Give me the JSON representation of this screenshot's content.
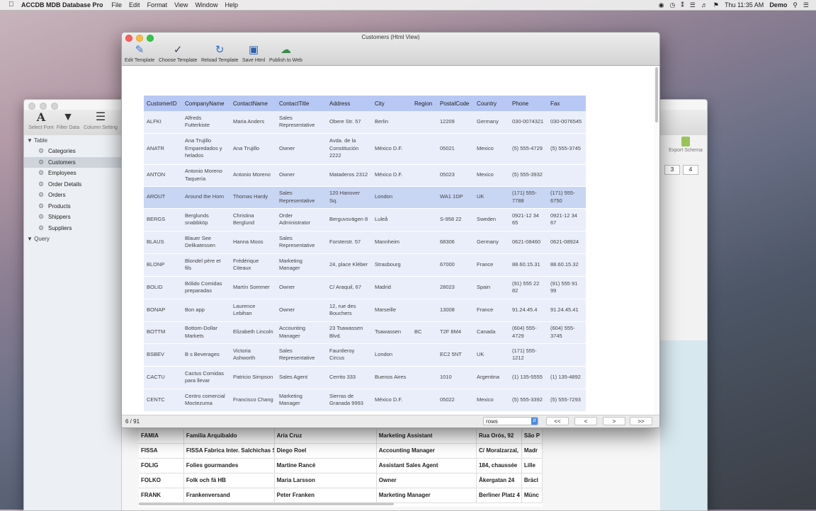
{
  "menubar": {
    "app_name": "ACCDB MDB Database Pro",
    "menus": [
      "File",
      "Edit",
      "Format",
      "View",
      "Window",
      "Help"
    ],
    "clock": "Thu 11:35 AM",
    "user": "Demo"
  },
  "bg_window": {
    "tools": [
      {
        "label": "Select Font",
        "icon": "font-icon"
      },
      {
        "label": "Filter Data",
        "icon": "filter-icon"
      },
      {
        "label": "Column Setting",
        "icon": "column-setting-icon"
      }
    ],
    "sidebar": {
      "table_header": "Table",
      "items": [
        "Categories",
        "Customers",
        "Employees",
        "Order Details",
        "Orders",
        "Products",
        "Shippers",
        "Suppliers"
      ],
      "selected": "Customers",
      "query_header": "Query"
    },
    "export_label": "Export Schema",
    "page_numbers": [
      "3",
      "4"
    ],
    "grid_rows": [
      [
        "FAMIA",
        "Familia Arquibaldo",
        "Aria Cruz",
        "Marketing Assistant",
        "Rua Orós, 92",
        "São P"
      ],
      [
        "FISSA",
        "FISSA Fabrica Inter. Salchichas S",
        "Diego Roel",
        "Accounting Manager",
        "C/ Moralzarzal,",
        "Madr"
      ],
      [
        "FOLIG",
        "Folies gourmandes",
        "Martine Rancé",
        "Assistant Sales Agent",
        "184, chaussée",
        "Lille"
      ],
      [
        "FOLKO",
        "Folk och fä HB",
        "Maria Larsson",
        "Owner",
        "Åkergatan 24",
        "Bräcl"
      ],
      [
        "FRANK",
        "Frankenversand",
        "Peter Franken",
        "Marketing Manager",
        "Berliner Platz 4",
        "Münc"
      ]
    ]
  },
  "window": {
    "title": "Customers (Html View)",
    "toolbar": [
      {
        "label": "Edit Template",
        "icon": "edit-template-icon"
      },
      {
        "label": "Choose Template",
        "icon": "choose-template-icon"
      },
      {
        "label": "Reload Template",
        "icon": "reload-template-icon"
      },
      {
        "label": "Save Html",
        "icon": "save-html-icon"
      },
      {
        "label": "Publish to Web",
        "icon": "publish-web-icon"
      }
    ],
    "columns": [
      "CustomerID",
      "CompanyName",
      "ContactName",
      "ContactTitle",
      "Address",
      "City",
      "Region",
      "PostalCode",
      "Country",
      "Phone",
      "Fax"
    ],
    "rows": [
      [
        "ALFKI",
        "Alfreds Futterkiste",
        "Maria Anders",
        "Sales Representative",
        "Obere Str. 57",
        "Berlin",
        "",
        "12209",
        "Germany",
        "030-0074321",
        "030-0076545"
      ],
      [
        "ANATR",
        "Ana Trujillo Emparedados y helados",
        "Ana Trujillo",
        "Owner",
        "Avda. de la Constitución 2222",
        "México D.F.",
        "",
        "05021",
        "Mexico",
        "(5) 555-4729",
        "(5) 555-3745"
      ],
      [
        "ANTON",
        "Antonio Moreno Taquería",
        "Antonio Moreno",
        "Owner",
        "Mataderos 2312",
        "México D.F.",
        "",
        "05023",
        "Mexico",
        "(5) 555-3932",
        ""
      ],
      [
        "AROUT",
        "Around the Horn",
        "Thomas Hardy",
        "Sales Representative",
        "120 Hanover Sq.",
        "London",
        "",
        "WA1 1DP",
        "UK",
        "(171) 555-7788",
        "(171) 555-6750"
      ],
      [
        "BERGS",
        "Berglunds snabbköp",
        "Christina Berglund",
        "Order Administrator",
        "Berguvsvägen 8",
        "Luleå",
        "",
        "S-958 22",
        "Sweden",
        "0921-12 34 65",
        "0921-12 34 67"
      ],
      [
        "BLAUS",
        "Blauer See Delikatessen",
        "Hanna Moos",
        "Sales Representative",
        "Forsterstr. 57",
        "Mannheim",
        "",
        "68306",
        "Germany",
        "0621-08460",
        "0621-08924"
      ],
      [
        "BLONP",
        "Blondel père et fils",
        "Frédérique Citeaux",
        "Marketing Manager",
        "24, place Kléber",
        "Strasbourg",
        "",
        "67000",
        "France",
        "88.60.15.31",
        "88.60.15.32"
      ],
      [
        "BOLID",
        "Bólido Comidas preparadas",
        "Martín Sommer",
        "Owner",
        "C/ Araquil, 67",
        "Madrid",
        "",
        "28023",
        "Spain",
        "(91) 555 22 82",
        "(91) 555 91 99"
      ],
      [
        "BONAP",
        "Bon app",
        "Laurence Lebihan",
        "Owner",
        "12, rue des Bouchers",
        "Marseille",
        "",
        "13008",
        "France",
        "91.24.45.4",
        "91.24.45.41"
      ],
      [
        "BOTTM",
        "Bottom-Dollar Markets",
        "Elizabeth Lincoln",
        "Accounting Manager",
        "23 Tsawassen Blvd.",
        "Tsawassen",
        "BC",
        "T2F 8M4",
        "Canada",
        "(604) 555-4729",
        "(604) 555-3745"
      ],
      [
        "BSBEV",
        "B s Beverages",
        "Victoria Ashworth",
        "Sales Representative",
        "Fauntleroy Circus",
        "London",
        "",
        "EC2 5NT",
        "UK",
        "(171) 555-1212",
        ""
      ],
      [
        "CACTU",
        "Cactus Comidas para llevar",
        "Patricio Simpson",
        "Sales Agent",
        "Cerrito 333",
        "Buenos Aires",
        "",
        "1010",
        "Argentina",
        "(1) 135-5555",
        "(1) 135-4892"
      ],
      [
        "CENTC",
        "Centro comercial Moctezuma",
        "Francisco Chang",
        "Marketing Manager",
        "Sierras de Granada 9993",
        "México D.F.",
        "",
        "05022",
        "Mexico",
        "(5) 555-3392",
        "(5) 555-7293"
      ]
    ],
    "selected_row": 3,
    "record_counter": "6 / 91",
    "rows_select": "rows",
    "nav": [
      "<<",
      "<",
      ">",
      ">>"
    ]
  }
}
